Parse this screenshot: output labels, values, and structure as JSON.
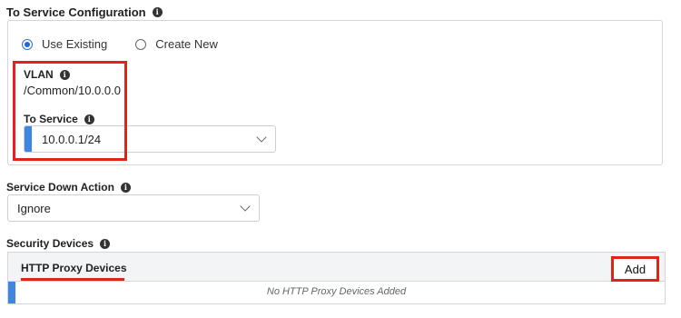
{
  "to_service_config": {
    "title": "To Service Configuration",
    "radio_options": [
      {
        "label": "Use Existing",
        "selected": true
      },
      {
        "label": "Create New",
        "selected": false
      }
    ],
    "vlan": {
      "label": "VLAN",
      "value": "/Common/10.0.0.0"
    },
    "to_service": {
      "label": "To Service",
      "selected": "10.0.0.1/24"
    }
  },
  "service_down_action": {
    "label": "Service Down Action",
    "selected": "Ignore"
  },
  "security_devices": {
    "label": "Security Devices",
    "table_title": "HTTP Proxy Devices",
    "add_label": "Add",
    "empty_text": "No HTTP Proxy Devices Added"
  },
  "colors": {
    "highlight": "#e0241b",
    "accent_blue": "#3d87e3"
  }
}
